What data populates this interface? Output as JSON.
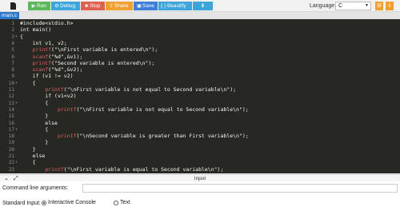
{
  "toolbar": {
    "file_icon": "file-icon",
    "run_label": "Run",
    "run_icon": "▶",
    "debug_label": "Debug",
    "debug_icon": "⚙",
    "stop_label": "Stop",
    "stop_icon": "■",
    "share_label": "Share",
    "share_icon": "⇪",
    "save_label": "Save",
    "save_icon": "▣",
    "beautify_label": "{ } Beautify",
    "download_icon": "⬇",
    "language_label": "Language",
    "language_value": "C",
    "gear_icon": "⚙",
    "info_icon": "i"
  },
  "tabs": [
    {
      "label": "main.c"
    }
  ],
  "editor": {
    "lines": [
      {
        "num": "1",
        "fold": "",
        "text": "#include<stdio.h>"
      },
      {
        "num": "2",
        "fold": "",
        "text": "int main()"
      },
      {
        "num": "3",
        "fold": "▾",
        "text": "{"
      },
      {
        "num": "4",
        "fold": "",
        "text": "    int v1, v2;"
      },
      {
        "num": "5",
        "fold": "",
        "text": "    printf(\"\\nFirst variable is entered\\n\");"
      },
      {
        "num": "6",
        "fold": "",
        "text": "    scanf(\"%d\",&v1);"
      },
      {
        "num": "7",
        "fold": "",
        "text": "    printf(\"Second variable is entered\\n\");"
      },
      {
        "num": "8",
        "fold": "",
        "text": "    scanf(\"%d\",&v2);"
      },
      {
        "num": "9",
        "fold": "",
        "text": "    if (v1 != v2)"
      },
      {
        "num": "10",
        "fold": "▾",
        "text": "    {"
      },
      {
        "num": "11",
        "fold": "",
        "text": "        printf(\"\\nFirst variable is not equal to Second variable\\n\");"
      },
      {
        "num": "12",
        "fold": "",
        "text": "        if (v1<v2)"
      },
      {
        "num": "13",
        "fold": "▾",
        "text": "        {"
      },
      {
        "num": "14",
        "fold": "",
        "text": "            printf(\"\\nFirst variable is not equal to Second variable\\n\");"
      },
      {
        "num": "15",
        "fold": "",
        "text": "        }"
      },
      {
        "num": "16",
        "fold": "",
        "text": "        else"
      },
      {
        "num": "17",
        "fold": "▾",
        "text": "        {"
      },
      {
        "num": "18",
        "fold": "",
        "text": "            printf(\"\\nSecond variable is greater than First variable\\n\");"
      },
      {
        "num": "19",
        "fold": "",
        "text": "        }"
      },
      {
        "num": "20",
        "fold": "",
        "text": "    }"
      },
      {
        "num": "21",
        "fold": "",
        "text": "    else"
      },
      {
        "num": "22",
        "fold": "▾",
        "text": "    {"
      },
      {
        "num": "23",
        "fold": "",
        "text": "        printf(\"\\nFirst variable is equal to Second variable\\n\");"
      }
    ]
  },
  "input_panel": {
    "title": "Input",
    "collapse_icon": "⌄",
    "expand_icon": "⤢",
    "command_line_label": "Command line arguments:",
    "command_line_value": "",
    "standard_input_label": "Standard Input:",
    "option_interactive": "Interactive Console",
    "option_text": "Text",
    "selected_option": "Interactive Console"
  }
}
